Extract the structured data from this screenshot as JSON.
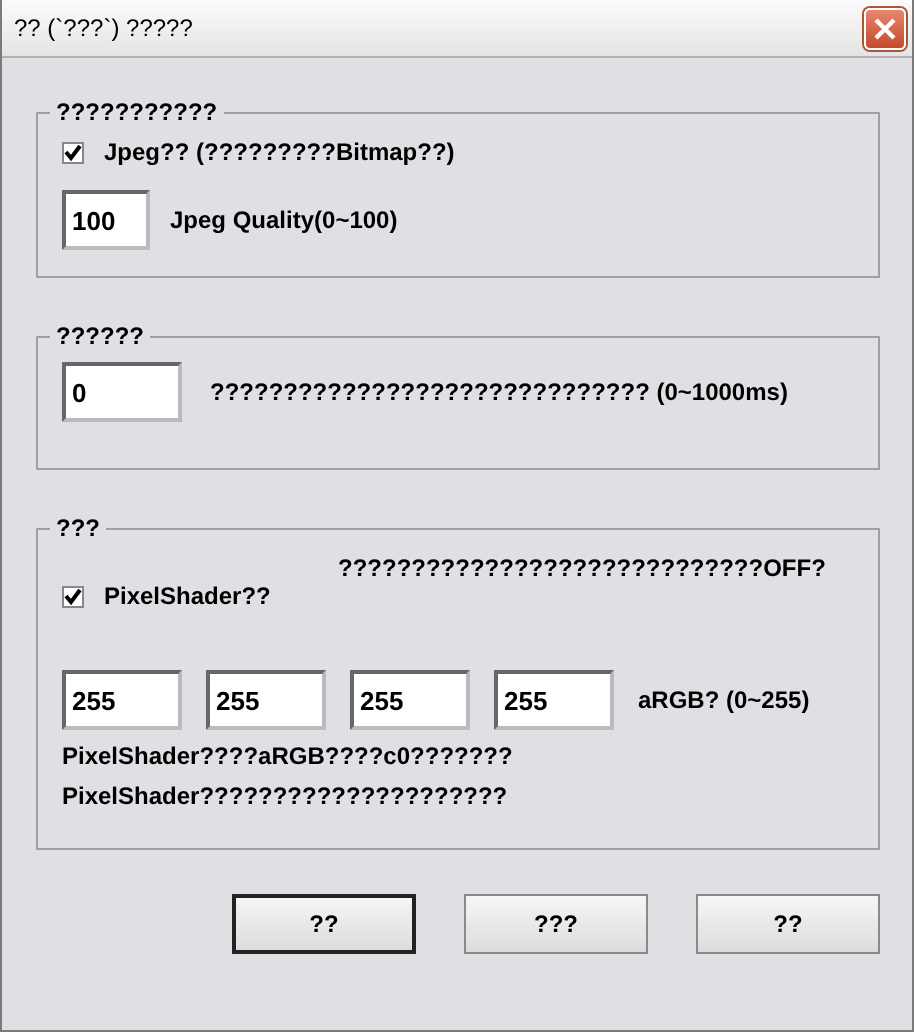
{
  "window": {
    "title": "?? (`???`) ?????"
  },
  "groups": [
    {
      "title": "???????????",
      "items": [
        {
          "kind": "checkbox",
          "label": "Jpeg?? (?????????Bitmap??)",
          "checked": true
        },
        {
          "kind": "field",
          "value": "100",
          "label": "Jpeg Quality(0~100)"
        }
      ]
    },
    {
      "title": "??????",
      "items": [
        {
          "kind": "field",
          "value": "0",
          "label": "?????????????????????????????? (0~1000ms)"
        }
      ]
    },
    {
      "title": "???",
      "items": [
        {
          "kind": "note",
          "label": "?????????????????????????????OFF?"
        },
        {
          "kind": "checkbox",
          "label": "PixelShader??",
          "checked": true
        },
        {
          "kind": "fields",
          "values": [
            "255",
            "255",
            "255",
            "255"
          ],
          "label": "aRGB? (0~255)"
        },
        {
          "kind": "text",
          "label": "PixelShader????aRGB????c0???????"
        },
        {
          "kind": "text",
          "label": "PixelShader?????????????????????"
        }
      ]
    }
  ],
  "buttons": [
    {
      "label": "??",
      "default": true
    },
    {
      "label": "???",
      "default": false
    },
    {
      "label": "??",
      "default": false
    }
  ]
}
